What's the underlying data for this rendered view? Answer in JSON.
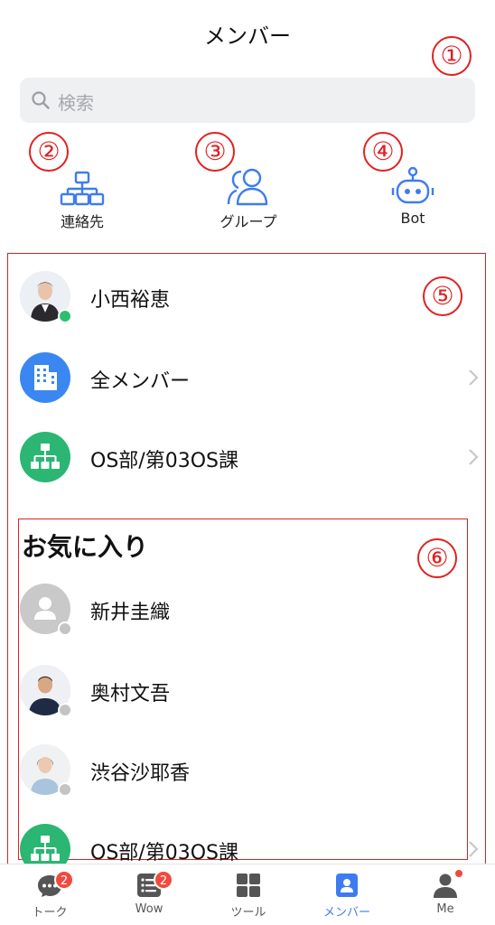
{
  "header": {
    "title": "メンバー"
  },
  "search": {
    "placeholder": "検索",
    "icon": "search-icon"
  },
  "callouts": [
    "①",
    "②",
    "③",
    "④",
    "⑤",
    "⑥"
  ],
  "quick_actions": [
    {
      "label": "連絡先",
      "icon": "org-chart-icon"
    },
    {
      "label": "グループ",
      "icon": "group-icon"
    },
    {
      "label": "Bot",
      "icon": "bot-icon"
    }
  ],
  "top_list": [
    {
      "name": "小西裕恵",
      "status": "online"
    },
    {
      "name": "全メンバー",
      "icon": "building-icon"
    },
    {
      "name": "OS部/第03OS課",
      "icon": "org-chart-icon"
    }
  ],
  "favorites": {
    "title": "お気に入り",
    "items": [
      {
        "name": "新井圭織",
        "status": "offline"
      },
      {
        "name": "奥村文吾",
        "status": "offline"
      },
      {
        "name": "渋谷沙耶香",
        "status": "offline"
      },
      {
        "name": "OS部/第03OS課"
      }
    ]
  },
  "tabbar": [
    {
      "label": "トーク",
      "badge": "2",
      "icon": "chat-icon"
    },
    {
      "label": "Wow",
      "badge": "2",
      "icon": "wow-list-icon"
    },
    {
      "label": "ツール",
      "icon": "grid-icon"
    },
    {
      "label": "メンバー",
      "icon": "contacts-icon",
      "active": true
    },
    {
      "label": "Me",
      "icon": "person-icon",
      "dot": true
    }
  ],
  "colors": {
    "accent": "#3d7cf0",
    "callout": "#e12121",
    "online": "#2bbf6e",
    "offline": "#c4c4c4",
    "org_green": "#2bb673",
    "building_blue": "#3a87f2"
  }
}
